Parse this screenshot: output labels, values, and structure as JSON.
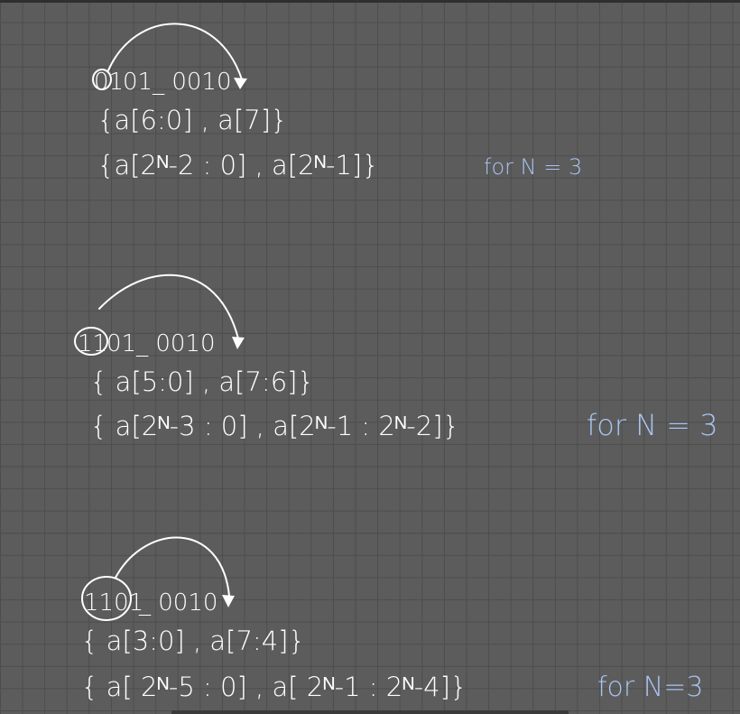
{
  "colors": {
    "ink": "#ffffff",
    "note": "#a9c3f0",
    "grid": "#4d4d4d",
    "background": "#5c5c5c"
  },
  "sections": [
    {
      "bits_head": "01",
      "bits_tail": "01_ 0010",
      "concat_literal": "{a[6:0] , a[7]}",
      "concat_general": "{a[2ᴺ-2 : 0] , a[2ᴺ-1]}",
      "note": "for N = 3"
    },
    {
      "bits_head": "11",
      "bits_tail": "01_ 0010",
      "concat_literal": "{ a[5:0] , a[7:6]}",
      "concat_general": "{ a[2ᴺ-3 : 0] , a[2ᴺ-1 : 2ᴺ-2]}",
      "note": "for N = 3"
    },
    {
      "bits_head": "1101",
      "bits_tail": "_ 0010",
      "concat_literal": "{ a[3:0] , a[7:4]}",
      "concat_general": "{ a[ 2ᴺ-5 : 0] , a[ 2ᴺ-1 : 2ᴺ-4]}",
      "note": "for N=3"
    }
  ]
}
